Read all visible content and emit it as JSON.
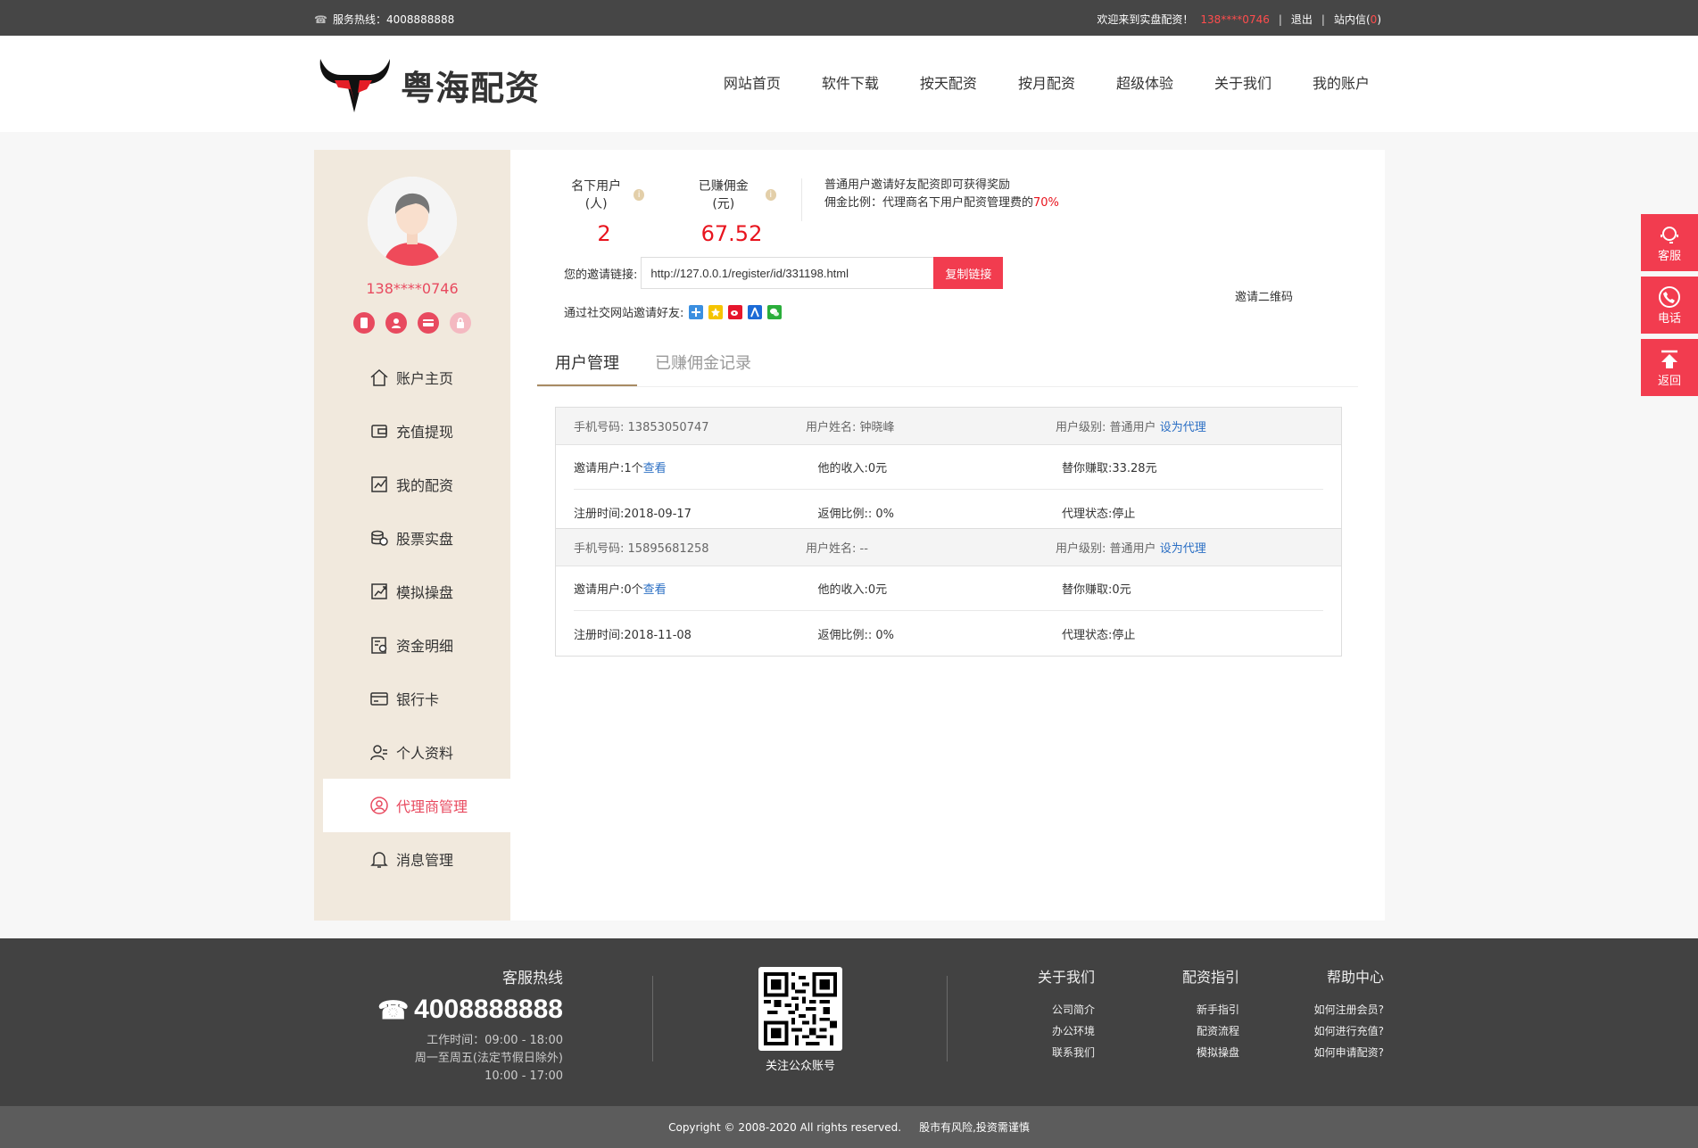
{
  "topbar": {
    "hotline_label": "服务热线：",
    "hotline_number": "4008888888",
    "welcome": "欢迎来到实盘配资！",
    "user_phone": "138****0746",
    "logout": "退出",
    "messages_label": "站内信",
    "messages_open": "(",
    "messages_count": "0",
    "messages_close": ")",
    "separator": "|"
  },
  "header": {
    "brand": "粤海配资",
    "nav": [
      "网站首页",
      "软件下载",
      "按天配资",
      "按月配资",
      "超级体验",
      "关于我们",
      "我的账户"
    ]
  },
  "sidebar": {
    "phone": "138****0746",
    "menu": [
      {
        "label": "账户主页",
        "icon": "home-icon"
      },
      {
        "label": "充值提现",
        "icon": "wallet-icon"
      },
      {
        "label": "我的配资",
        "icon": "chart-icon"
      },
      {
        "label": "股票实盘",
        "icon": "coins-icon"
      },
      {
        "label": "模拟操盘",
        "icon": "trend-icon"
      },
      {
        "label": "资金明细",
        "icon": "ledger-icon"
      },
      {
        "label": "银行卡",
        "icon": "card-icon"
      },
      {
        "label": "个人资料",
        "icon": "user-icon"
      },
      {
        "label": "代理商管理",
        "icon": "agent-icon",
        "active": true
      },
      {
        "label": "消息管理",
        "icon": "bell-icon"
      }
    ]
  },
  "stats": {
    "users_label": "名下用户(人)",
    "users_value": "2",
    "commission_label": "已赚佣金 (元)",
    "commission_value": "67.52",
    "desc_line1": "普通用户邀请好友配资即可获得奖励",
    "desc_line2": "佣金比例：代理商名下用户配资管理费的",
    "desc_rate": "70%"
  },
  "invite": {
    "label": "您的邀请链接:",
    "link": "http://127.0.0.1/register/id/331198.html",
    "copy_button": "复制链接",
    "social_label": "通过社交网站邀请好友:",
    "qr_label": "邀请二维码"
  },
  "tabs": [
    "用户管理",
    "已赚佣金记录"
  ],
  "users": [
    {
      "phone_label": "手机号码:",
      "phone": "13853050747",
      "name_label": "用户姓名:",
      "name": "钟晓峰",
      "level_label": "用户级别:",
      "level": "普通用户",
      "set_agent": "设为代理",
      "invited_label": "邀请用户:",
      "invited": "1个",
      "view": "查看",
      "income_label": "他的收入:",
      "income": "0元",
      "earned_label": "替你赚取:",
      "earned": "33.28元",
      "reg_label": "注册时间:",
      "reg": "2018-09-17",
      "rebate_label": "返佣比例::",
      "rebate": "0%",
      "status_label": "代理状态:",
      "status": "停止"
    },
    {
      "phone_label": "手机号码:",
      "phone": "15895681258",
      "name_label": "用户姓名:",
      "name": "--",
      "level_label": "用户级别:",
      "level": "普通用户",
      "set_agent": "设为代理",
      "invited_label": "邀请用户:",
      "invited": "0个",
      "view": "查看",
      "income_label": "他的收入:",
      "income": "0元",
      "earned_label": "替你赚取:",
      "earned": "0元",
      "reg_label": "注册时间:",
      "reg": "2018-11-08",
      "rebate_label": "返佣比例::",
      "rebate": "0%",
      "status_label": "代理状态:",
      "status": "停止"
    }
  ],
  "side_tools": [
    "客服",
    "电话",
    "返回"
  ],
  "footer": {
    "hotline_title": "客服热线",
    "hotline_number": "4008888888",
    "work_time": "工作时间：09:00 - 18:00",
    "work_days": "周一至周五(法定节假日除外)",
    "work_time2": "10:00 - 17:00",
    "qr_caption": "关注公众账号",
    "columns": [
      {
        "title": "关于我们",
        "links": [
          "公司简介",
          "办公环境",
          "联系我们"
        ]
      },
      {
        "title": "配资指引",
        "links": [
          "新手指引",
          "配资流程",
          "模拟操盘"
        ]
      },
      {
        "title": "帮助中心",
        "links": [
          "如何注册会员?",
          "如何进行充值?",
          "如何申请配资?"
        ]
      }
    ],
    "copyright": "Copyright © 2008-2020 All rights reserved.",
    "risk": "股市有风险,投资需谨慎"
  },
  "colors": {
    "accent": "#f23c4f",
    "sidebar_bg": "#f1e9dd",
    "topbar_bg": "#464646",
    "footer_bg": "#424242",
    "link": "#2b6fc4"
  }
}
